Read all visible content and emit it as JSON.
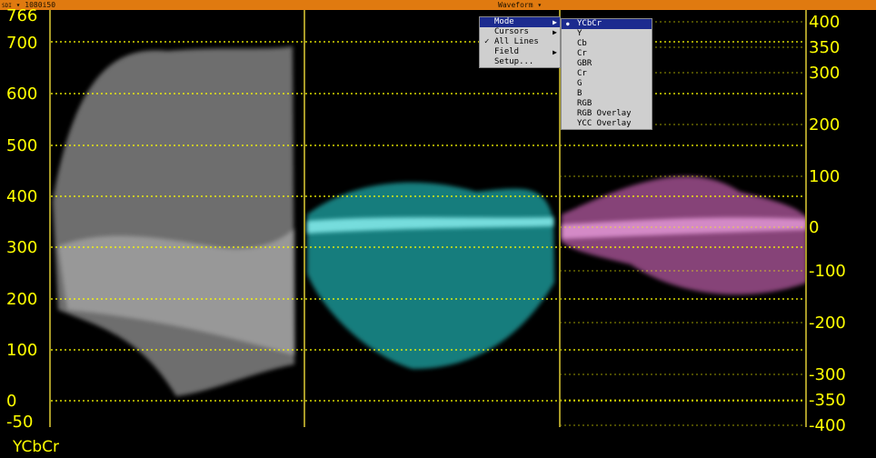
{
  "topbar": {
    "source": "SDI",
    "format": "1080i50",
    "title": "Waveform ▾"
  },
  "mode_label": "YCbCr",
  "left_axis_labels": [
    "766",
    "700",
    "600",
    "500",
    "400",
    "300",
    "200",
    "100",
    "0",
    "-50"
  ],
  "right_axis_labels": [
    "400",
    "350",
    "300",
    "200",
    "100",
    "0",
    "-100",
    "-200",
    "-300",
    "-350",
    "-400"
  ],
  "main_menu": [
    {
      "label": "Mode",
      "submenu": true,
      "selected": true,
      "checked": false
    },
    {
      "label": "Cursors",
      "submenu": true,
      "selected": false,
      "checked": false
    },
    {
      "label": "All Lines",
      "submenu": false,
      "selected": false,
      "checked": true
    },
    {
      "label": "Field",
      "submenu": true,
      "selected": false,
      "checked": false
    },
    {
      "label": "Setup...",
      "submenu": false,
      "selected": false,
      "checked": false
    }
  ],
  "mode_submenu": [
    "YCbCr",
    "Y",
    "Cb",
    "Cr",
    "GBR",
    "Cr",
    "G",
    "B",
    "RGB",
    "RGB Overlay",
    "YCC Overlay"
  ],
  "mode_selected": "YCbCr",
  "colors": {
    "graticule": "#ffff00",
    "luma_trace": "#c8c8c8",
    "cb_trace": "#25d0d0",
    "cr_trace": "#e070c8",
    "accent_bar": "#e07a10",
    "menu_highlight": "#1c2b8f"
  }
}
